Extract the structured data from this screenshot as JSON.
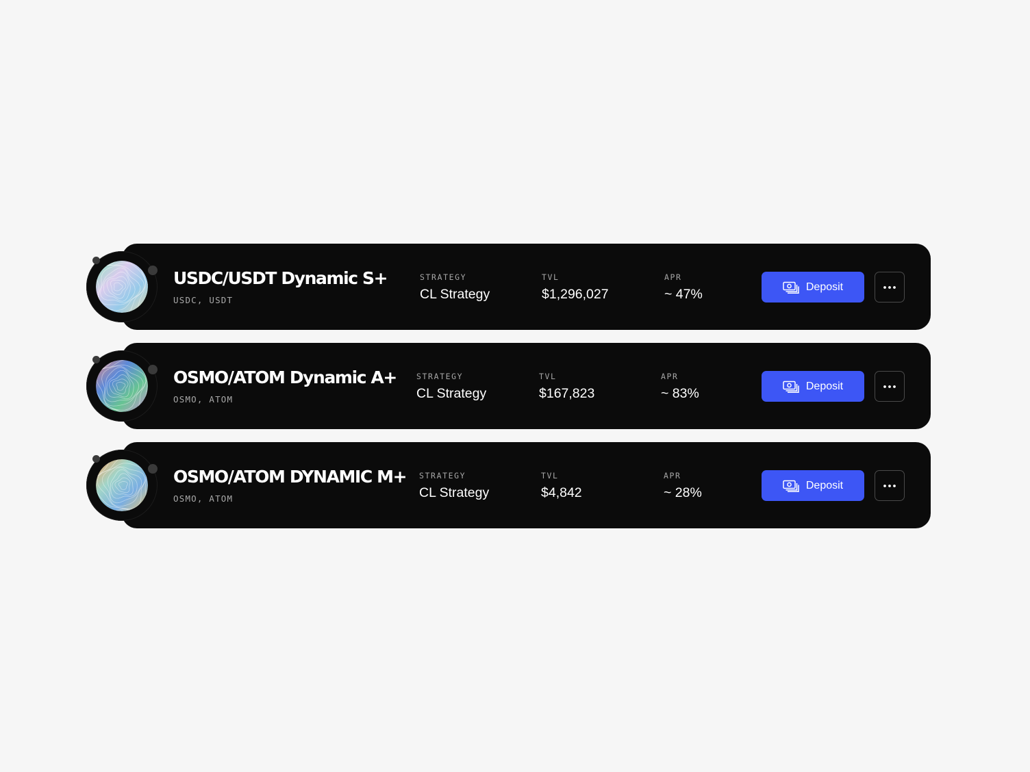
{
  "vaults": [
    {
      "name": "USDC/USDT Dynamic S+",
      "assets": "USDC, USDT",
      "strategy_label": "STRATEGY",
      "strategy_value": "CL Strategy",
      "tvl_label": "TVL",
      "tvl_value": "$1,296,027",
      "apr_label": "APR",
      "apr_value": "~ 47%",
      "deposit_label": "Deposit",
      "orb_colors": [
        "#7ee0b4",
        "#d7c8ec",
        "#8ec6e8",
        "#e8d9a8"
      ]
    },
    {
      "name": "OSMO/ATOM Dynamic A+",
      "assets": "OSMO, ATOM",
      "strategy_label": "STRATEGY",
      "strategy_value": "CL Strategy",
      "tvl_label": "TVL",
      "tvl_value": "$167,823",
      "apr_label": "APR",
      "apr_value": "~ 83%",
      "deposit_label": "Deposit",
      "orb_colors": [
        "#e0857a",
        "#4f7fd6",
        "#5bbf8a",
        "#c88ad0"
      ]
    },
    {
      "name": "OSMO/ATOM DYNAMIC M+",
      "assets": "OSMO, ATOM",
      "strategy_label": "STRATEGY",
      "strategy_value": "CL Strategy",
      "tvl_label": "TVL",
      "tvl_value": "$4,842",
      "apr_label": "APR",
      "apr_value": "~ 28%",
      "deposit_label": "Deposit",
      "orb_colors": [
        "#f19a55",
        "#9ad2c4",
        "#6fa8e0",
        "#e8c36b"
      ]
    }
  ],
  "icons": {
    "logo": "vault-orb-icon",
    "deposit": "cash-icon",
    "more": "more-horizontal-icon"
  },
  "colors": {
    "background": "#f6f6f6",
    "card": "#0b0b0b",
    "accent": "#3d56f5"
  }
}
